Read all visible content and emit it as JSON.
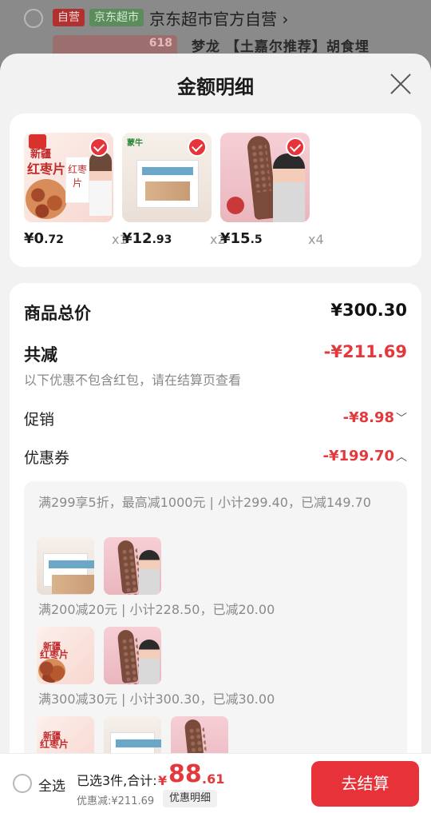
{
  "background": {
    "tag_self": "自营",
    "tag_super": "京东超市",
    "store_name": "京东超市官方自营",
    "store_chevron": "›",
    "thumb_badge": "618",
    "product_title": "梦龙 【土嘉尔推荐】胡食埋"
  },
  "sheet": {
    "title": "金额明细",
    "close_icon": "close-icon"
  },
  "products": [
    {
      "price_currency": "¥",
      "price_int": "0",
      "price_dec": ".72",
      "qty": "x1",
      "img_t1": "新疆",
      "img_t2": "红枣片",
      "img_pack": "红枣片"
    },
    {
      "price_currency": "¥",
      "price_int": "12",
      "price_dec": ".93",
      "qty": "x2",
      "img_logo": "蒙牛"
    },
    {
      "price_currency": "¥",
      "price_int": "15",
      "price_dec": ".5",
      "qty": "x4"
    }
  ],
  "summary": {
    "total_label": "商品总价",
    "total_value": "¥300.30",
    "discount_label": "共减",
    "discount_value": "-¥211.69",
    "discount_note": "以下优惠不包含红包，请在结算页查看",
    "promo_label": "促销",
    "promo_value": "-¥8.98",
    "promo_chevron": "﹀",
    "coupon_label": "优惠券",
    "coupon_value": "-¥199.70",
    "coupon_chevron": "︿"
  },
  "coupons": [
    {
      "text": "满299享5折，最高减1000元 | 小计299.40，已减149.70"
    },
    {
      "text": "满200减20元 | 小计228.50，已减20.00"
    },
    {
      "text": "满300减30元 | 小计300.30，已减30.00"
    }
  ],
  "bottom_bar": {
    "select_all": "全选",
    "selected_text": "已选3件,合计:",
    "total_currency": "¥",
    "total_int": "88",
    "total_dec": ".61",
    "discount_text": "优惠减:¥211.69",
    "detail_button": "优惠明细",
    "checkout_button": "去结算"
  },
  "colors": {
    "accent_red": "#e4393c",
    "checkout_red": "#e8323a"
  }
}
